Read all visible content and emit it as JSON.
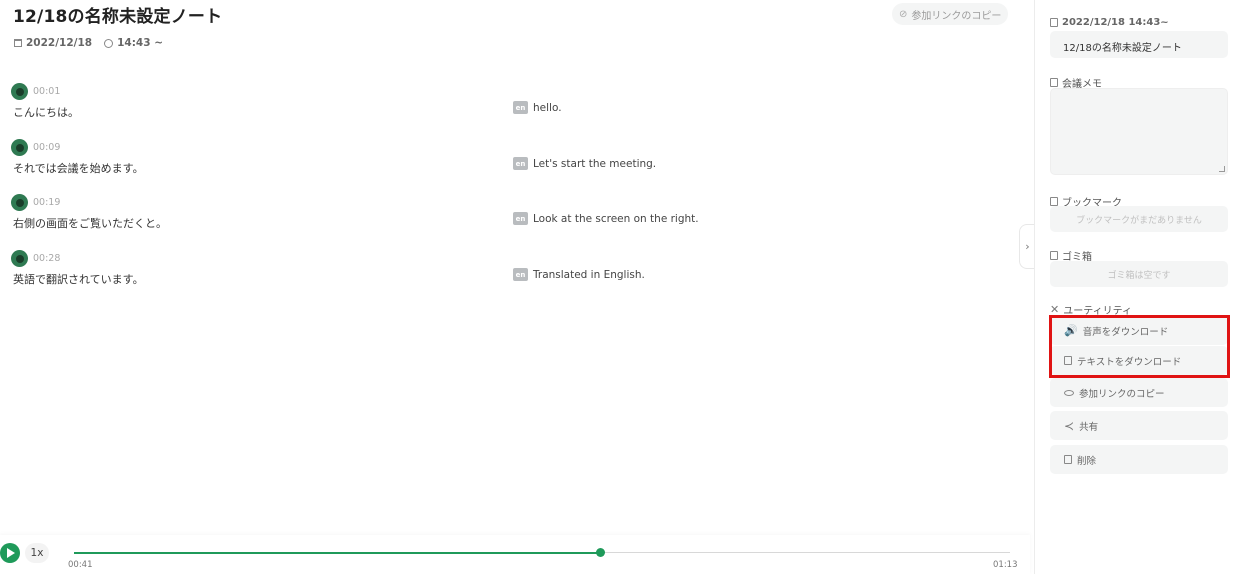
{
  "header": {
    "title": "12/18の名称未設定ノート",
    "copy_link_label": "参加リンクのコピー",
    "date": "2022/12/18",
    "time": "14:43 ~"
  },
  "transcript": [
    {
      "time": "00:01",
      "ja": "こんにちは。",
      "lang": "en",
      "translation": "hello."
    },
    {
      "time": "00:09",
      "ja": "それでは会議を始めます。",
      "lang": "en",
      "translation": "Let's start the meeting."
    },
    {
      "time": "00:19",
      "ja": "右側の画面をご覧いただくと。",
      "lang": "en",
      "translation": "Look at the screen on the right."
    },
    {
      "time": "00:28",
      "ja": "英語で翻訳されています。",
      "lang": "en",
      "translation": "Translated in English."
    }
  ],
  "player": {
    "speed": "1x",
    "current": "00:41",
    "duration": "01:13",
    "progress": 0.562,
    "accent_color": "#1f9a5a"
  },
  "sidebar": {
    "datetime": "2022/12/18 14:43~",
    "note_title": "12/18の名称未設定ノート",
    "memo_label": "会議メモ",
    "bookmark_label": "ブックマーク",
    "bookmark_empty": "ブックマークがまだありません",
    "trash_label": "ゴミ箱",
    "trash_empty": "ゴミ箱は空です",
    "utility_label": "ユーティリティ",
    "utilities": [
      {
        "label": "音声をダウンロード",
        "icon": "audio-download-icon"
      },
      {
        "label": "テキストをダウンロード",
        "icon": "text-download-icon"
      },
      {
        "label": "参加リンクのコピー",
        "icon": "link-icon"
      },
      {
        "label": "共有",
        "icon": "share-icon"
      },
      {
        "label": "削除",
        "icon": "trash-icon"
      }
    ]
  },
  "highlight_color": "#e01313"
}
